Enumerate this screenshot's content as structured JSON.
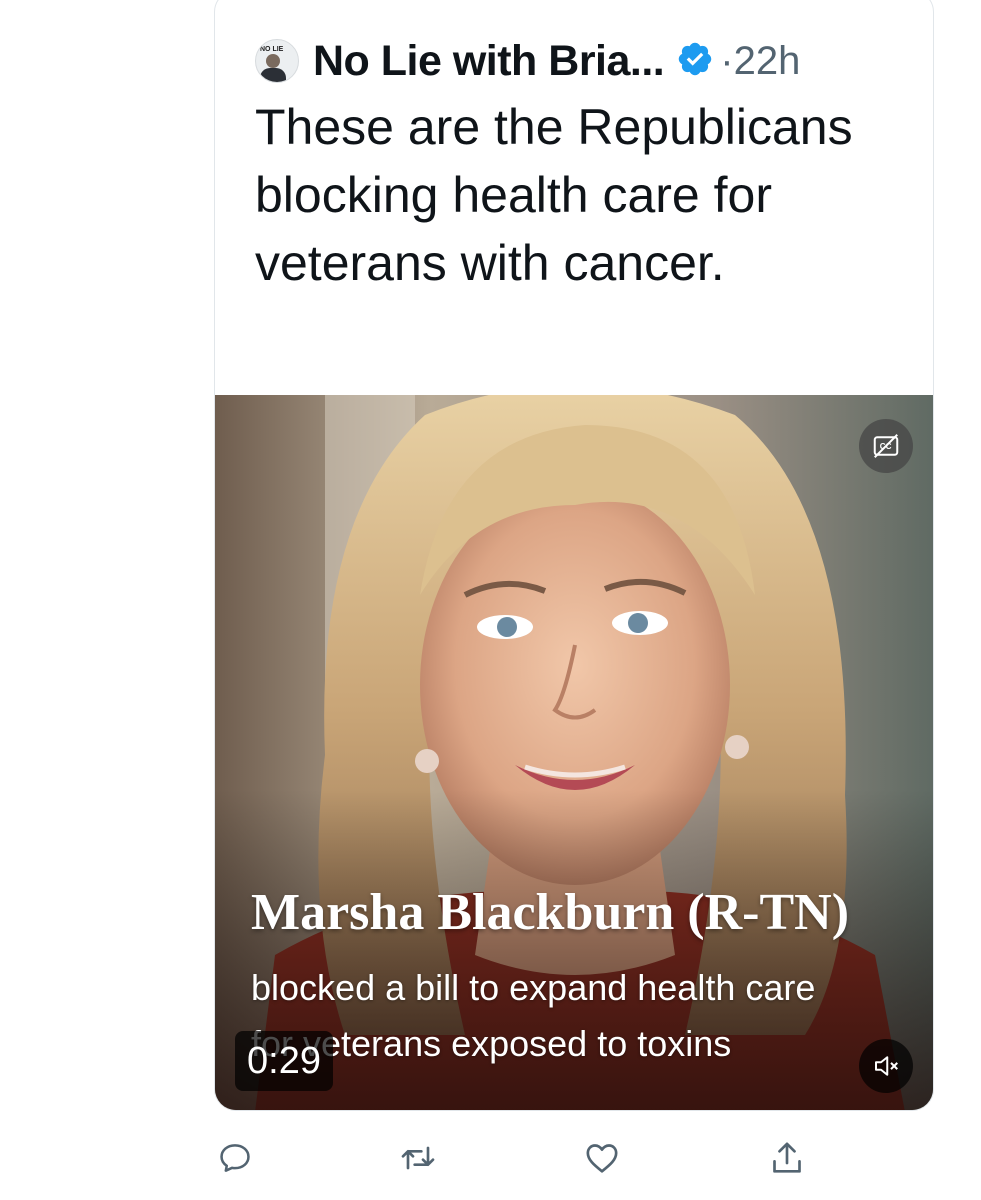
{
  "tweet": {
    "author_name": "No Lie with Bria...",
    "separator": "·",
    "time": "22h",
    "avatar_text": "NO LIE",
    "text": "These are the Republicans blocking health care for veterans with cancer."
  },
  "video": {
    "caption_name": "Marsha Blackburn (R-TN)",
    "caption_line1": "blocked a bill to expand health care",
    "caption_line2": "for veterans exposed to toxins",
    "duration": "0:29",
    "cc_icon": "closed-captions-off-icon",
    "mute_icon": "volume-muted-icon"
  },
  "actions": [
    {
      "name": "reply",
      "icon": "reply-icon"
    },
    {
      "name": "retweet",
      "icon": "retweet-icon"
    },
    {
      "name": "like",
      "icon": "heart-icon"
    },
    {
      "name": "share",
      "icon": "share-icon"
    }
  ],
  "colors": {
    "text": "#0f1419",
    "secondary": "#536471",
    "verified": "#1d9bf0",
    "border": "#e1e6ea"
  }
}
